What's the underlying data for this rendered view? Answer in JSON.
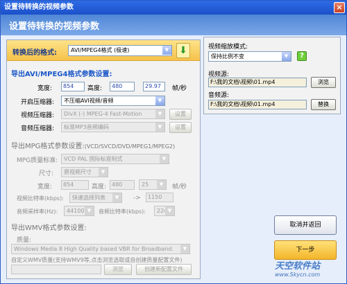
{
  "window": {
    "title": "设置待转换的视频参数",
    "close_glyph": "×"
  },
  "header": {
    "title": "设置待转换的视频参数"
  },
  "format": {
    "label": "转换后的格式:",
    "value": "AVI/MPEG4格式   (极速)",
    "apply_icon": "download-arrow-icon"
  },
  "avi": {
    "section": "导出AVI/MPEG4格式参数设置:",
    "width_label": "宽度:",
    "width": "854",
    "height_label": "高度:",
    "height": "480",
    "fps": "29.97",
    "fps_unit": "帧/秒",
    "compressor_label": "开启压缩器:",
    "compressor": "不压缩AVI视频/音频",
    "video_comp_label": "视频压缩器:",
    "video_comp": "DivX (-) MPEG-4 Fast-Motion",
    "video_settings": "设置",
    "audio_comp_label": "音频压缩器:",
    "audio_comp": "标准MP3音频编码",
    "audio_settings": "设置"
  },
  "mpg": {
    "section": "导出MPG格式参数设置:",
    "section_hint": "(VCD/SVCD/DVD/MPEG1/MPEG2)",
    "quality_label": "MPG质量标准:",
    "quality": "VCD  PAL  国际标准制式",
    "size_label": "尺寸:",
    "size": "原视频尺寸",
    "width_label": "宽度:",
    "width": "854",
    "height_label": "高度:",
    "height": "480",
    "fps": "25",
    "fps_unit": "帧/秒",
    "vbitrate_label": "视频比特率(kbps):",
    "vbitrate": "快速选择列表",
    "arrow": "->",
    "vbitrate_value": "1150",
    "asample_label": "音频采样率(Hz):",
    "asample": "44100",
    "abitrate_label": "音频比特率(kbps):",
    "abitrate": "224"
  },
  "wmv": {
    "section": "导出WMV格式参数设置:",
    "quality_label": "质量:",
    "quality": "Windows Media 8 High Quality based VBR for Broadband.",
    "custom_label": "自定义WMV质量(支持WMV9等,点击浏览选取或自创建质量配置文件)",
    "browse": "浏览",
    "create": "创建新配置文件"
  },
  "right": {
    "scale_label": "视频缩放模式:",
    "scale_mode": "保持比例不变",
    "video_source_label": "视频源:",
    "video_source": "F:\\我的文档\\视频\\01.mp4",
    "browse": "浏览",
    "audio_source_label": "音频源:",
    "audio_source": "F:\\我的文档\\视频\\01.mp4",
    "replace": "替换"
  },
  "actions": {
    "cancel": "取消并返回",
    "next": "下一步"
  },
  "watermark": {
    "line1": "天空软件站",
    "line2": "www.Skycn.com"
  }
}
